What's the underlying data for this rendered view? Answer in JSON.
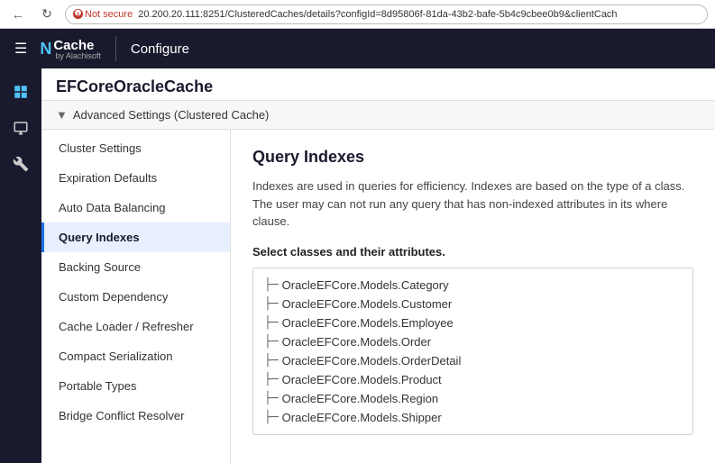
{
  "browser": {
    "back_label": "←",
    "refresh_label": "↻",
    "not_secure": "Not secure",
    "url": "20.200.20.111:8251/ClusteredCaches/details?configId=8d95806f-81da-43b2-bafe-5b4c9cbee0b9&clientCach"
  },
  "navbar": {
    "menu_icon": "☰",
    "brand_logo": "N",
    "brand_name": "Cache",
    "brand_by": "by Alachisoft",
    "title": "Configure"
  },
  "icon_sidebar": [
    {
      "name": "dashboard-icon",
      "icon": "⊞"
    },
    {
      "name": "monitor-icon",
      "icon": "🖥"
    },
    {
      "name": "tools-icon",
      "icon": "🔧"
    }
  ],
  "page": {
    "title": "EFCoreOracleCache",
    "section_header": "Advanced Settings (Clustered Cache)",
    "collapse_icon": "▼"
  },
  "left_nav": {
    "items": [
      {
        "id": "cluster-settings",
        "label": "Cluster Settings",
        "active": false
      },
      {
        "id": "expiration-defaults",
        "label": "Expiration Defaults",
        "active": false
      },
      {
        "id": "auto-data-balancing",
        "label": "Auto Data Balancing",
        "active": false
      },
      {
        "id": "query-indexes",
        "label": "Query Indexes",
        "active": true
      },
      {
        "id": "backing-source",
        "label": "Backing Source",
        "active": false
      },
      {
        "id": "custom-dependency",
        "label": "Custom Dependency",
        "active": false
      },
      {
        "id": "cache-loader",
        "label": "Cache Loader / Refresher",
        "active": false
      },
      {
        "id": "compact-serialization",
        "label": "Compact Serialization",
        "active": false
      },
      {
        "id": "portable-types",
        "label": "Portable Types",
        "active": false
      },
      {
        "id": "bridge-conflict",
        "label": "Bridge Conflict Resolver",
        "active": false
      }
    ]
  },
  "panel": {
    "title": "Query Indexes",
    "description": "Indexes are used in queries for efficiency. Indexes are based on the type of a class. The user may can not run any query that has non-indexed attributes in its where clause.",
    "select_label": "Select classes and their attributes.",
    "tree_items": [
      {
        "label": "OracleEFCore.Models.Category"
      },
      {
        "label": "OracleEFCore.Models.Customer"
      },
      {
        "label": "OracleEFCore.Models.Employee"
      },
      {
        "label": "OracleEFCore.Models.Order"
      },
      {
        "label": "OracleEFCore.Models.OrderDetail"
      },
      {
        "label": "OracleEFCore.Models.Product"
      },
      {
        "label": "OracleEFCore.Models.Region"
      },
      {
        "label": "OracleEFCore.Models.Shipper"
      }
    ],
    "tree_connector": "├─"
  }
}
